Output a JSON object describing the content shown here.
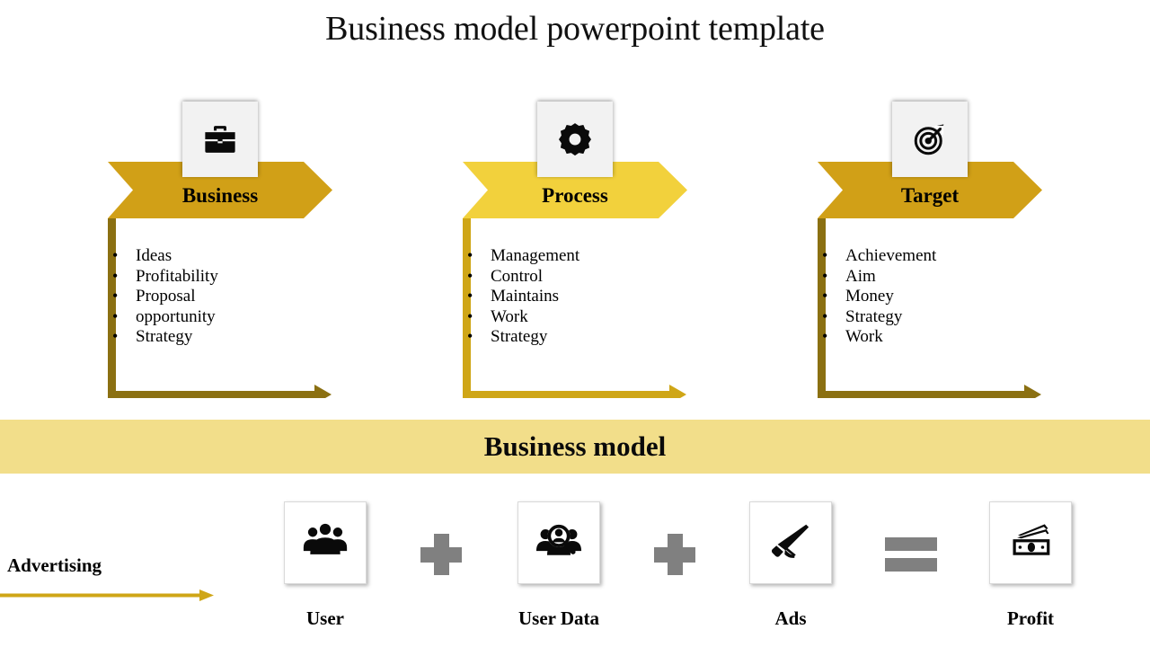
{
  "title": "Business model powerpoint template",
  "colors": {
    "gold_dark": "#D1A017",
    "gold_bright": "#F2D13C",
    "bracket_dark": "#8B7012",
    "bracket_bright": "#CFA617",
    "band": "#F2DE8A",
    "operator_gray": "#808080",
    "icon_card": "#F2F2F2"
  },
  "columns": [
    {
      "id": "business",
      "heading": "Business",
      "icon": "briefcase-icon",
      "chevron_color": "#D1A017",
      "bracket_color": "#8B7012",
      "items": [
        "Ideas",
        "Profitability",
        "Proposal",
        "opportunity",
        "Strategy"
      ]
    },
    {
      "id": "process",
      "heading": "Process",
      "icon": "gear-icon",
      "chevron_color": "#F2D13C",
      "bracket_color": "#CFA617",
      "items": [
        "Management",
        "Control",
        "Maintains",
        "Work",
        "Strategy"
      ]
    },
    {
      "id": "target",
      "heading": "Target",
      "icon": "target-icon",
      "chevron_color": "#D1A017",
      "bracket_color": "#8B7012",
      "items": [
        "Achievement",
        "Aim",
        "Money",
        "Strategy",
        "Work"
      ]
    }
  ],
  "band": {
    "label": "Business model"
  },
  "advertising": {
    "label": "Advertising",
    "arrow_color": "#CFA617"
  },
  "equation": {
    "items": [
      {
        "id": "user",
        "caption": "User",
        "icon": "people-group-icon"
      },
      {
        "id": "user-data",
        "caption": "User Data",
        "icon": "people-search-icon"
      },
      {
        "id": "ads",
        "caption": "Ads",
        "icon": "megaphone-icon"
      },
      {
        "id": "profit",
        "caption": "Profit",
        "icon": "banknotes-icon"
      }
    ],
    "operators": [
      "plus",
      "plus",
      "equals"
    ],
    "bullet": "•"
  }
}
